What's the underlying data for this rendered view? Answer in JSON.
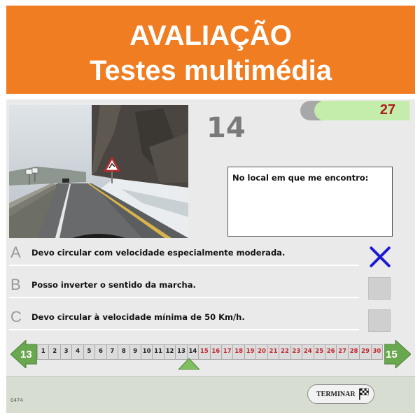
{
  "banner": {
    "line1": "AVALIAÇÃO",
    "line2": "Testes multimédia"
  },
  "quiz": {
    "question_number": "14",
    "timer_value": "27",
    "question_text": "No local em que me encontro:",
    "answers": [
      {
        "letter": "A",
        "text": "Devo circular com velocidade especialmente moderada.",
        "state": "selected"
      },
      {
        "letter": "B",
        "text": "Posso inverter o sentido da marcha.",
        "state": "empty"
      },
      {
        "letter": "C",
        "text": "Devo circular à velocidade mínima de 50 Km/h.",
        "state": "empty"
      }
    ]
  },
  "navigation": {
    "prev_label": "13",
    "next_label": "15",
    "current": 14,
    "questions": [
      "1",
      "2",
      "3",
      "4",
      "5",
      "6",
      "7",
      "8",
      "9",
      "10",
      "11",
      "12",
      "13",
      "14",
      "15",
      "16",
      "17",
      "18",
      "19",
      "20",
      "21",
      "22",
      "23",
      "24",
      "25",
      "26",
      "27",
      "28",
      "29",
      "30"
    ],
    "answered_upto": 14
  },
  "footer": {
    "code": "0474",
    "end_button": "TERMINAR"
  },
  "colors": {
    "banner": "#f07d22",
    "cross": "#1a1ad6",
    "timer_bg": "#c4ecaa",
    "timer_text": "#b01e1e",
    "nav_arrow": "#6aa84f",
    "pending_num": "#c0282d"
  },
  "icons": {
    "selected_mark": "x-mark-icon",
    "finish": "checkered-flag-icon"
  }
}
